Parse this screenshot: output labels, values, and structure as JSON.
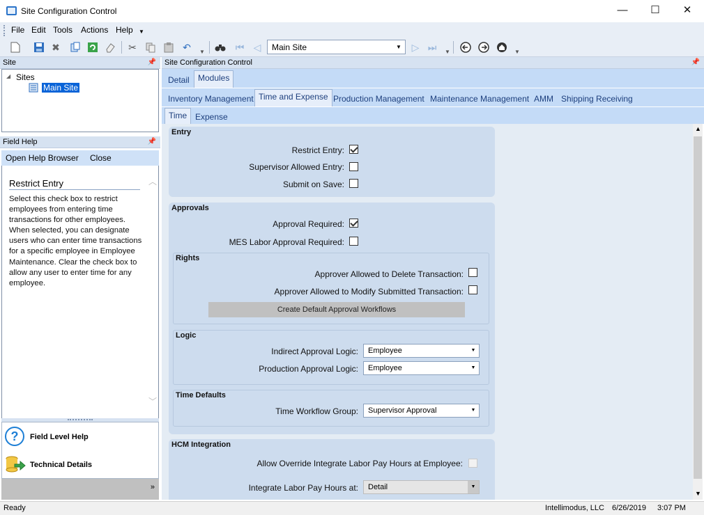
{
  "window": {
    "title": "Site Configuration Control",
    "minimize": "—",
    "maximize": "☐",
    "close": "✕"
  },
  "menu": [
    "File",
    "Edit",
    "Tools",
    "Actions",
    "Help"
  ],
  "toolbar": {
    "site_combo_value": "Main Site"
  },
  "site_pane": {
    "header": "Site",
    "tree_root": "Sites",
    "tree_item": "Main Site"
  },
  "field_help": {
    "header": "Field Help",
    "open_browser": "Open Help Browser",
    "close": "Close",
    "title": "Restrict Entry",
    "text": "Select this check box to restrict employees from entering time transactions for other employees. When selected, you can designate users who can enter time transactions for a specific employee in Employee Maintenance. Clear the check box to allow any user to enter time for any employee.",
    "nav_field_level_help": "Field Level Help",
    "nav_technical_details": "Technical Details"
  },
  "main": {
    "header": "Site Configuration Control",
    "tabs1": [
      "Detail",
      "Modules"
    ],
    "tabs2": [
      "Inventory Management",
      "Time and Expense",
      "Production Management",
      "Maintenance Management",
      "AMM",
      "Shipping Receiving"
    ],
    "tabs3": [
      "Time",
      "Expense"
    ]
  },
  "entry": {
    "title": "Entry",
    "restrict_entry": "Restrict Entry:",
    "supervisor_allowed_entry": "Supervisor Allowed Entry:",
    "submit_on_save": "Submit on Save:"
  },
  "approvals": {
    "title": "Approvals",
    "approval_required": "Approval Required:",
    "mes_labor_approval": "MES Labor Approval Required:",
    "rights_title": "Rights",
    "approver_delete": "Approver Allowed to Delete Transaction:",
    "approver_modify": "Approver Allowed to Modify Submitted Transaction:",
    "create_workflows_button": "Create Default Approval Workflows",
    "logic_title": "Logic",
    "indirect_logic_label": "Indirect Approval Logic:",
    "indirect_logic_value": "Employee",
    "production_logic_label": "Production Approval Logic:",
    "production_logic_value": "Employee",
    "time_defaults_title": "Time Defaults",
    "workflow_group_label": "Time Workflow Group:",
    "workflow_group_value": "Supervisor Approval"
  },
  "hcm": {
    "title": "HCM Integration",
    "allow_override": "Allow Override Integrate Labor Pay Hours at Employee:",
    "integrate_at_label": "Integrate Labor Pay Hours at:",
    "integrate_at_value": "Detail"
  },
  "status": {
    "ready": "Ready",
    "company": "Intellimodus, LLC",
    "date": "6/26/2019",
    "time": "3:07 PM"
  }
}
